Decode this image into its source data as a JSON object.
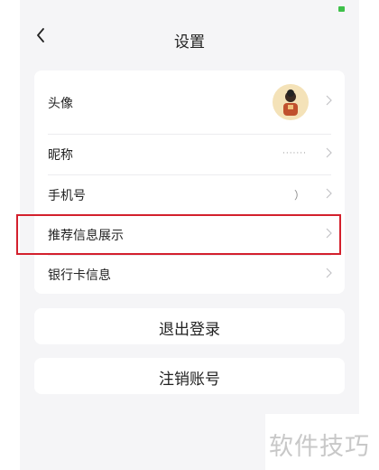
{
  "header": {
    "back_icon": "chevron-left-icon",
    "title": "设置"
  },
  "menu": {
    "avatar_label": "头像",
    "nickname_label": "昵称",
    "nickname_value": "·······",
    "phone_label": "手机号",
    "phone_value": "）",
    "recommend_label": "推荐信息展示",
    "bankcard_label": "银行卡信息"
  },
  "buttons": {
    "logout": "退出登录",
    "deactivate": "注销账号"
  },
  "watermark": "软件技巧",
  "colors": {
    "highlight": "#d3202d",
    "background": "#f5f5f7",
    "battery": "#3ec04a"
  }
}
